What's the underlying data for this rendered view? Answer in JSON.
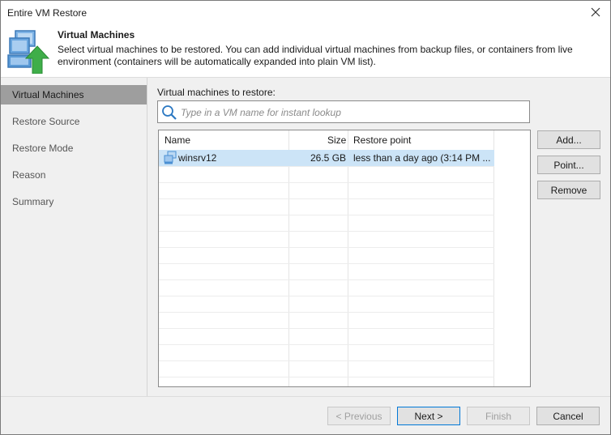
{
  "window": {
    "title": "Entire VM Restore"
  },
  "header": {
    "title": "Virtual Machines",
    "description": "Select virtual machines to be restored. You can add individual virtual machines from backup files, or containers from live environment (containers will be automatically expanded into plain VM list)."
  },
  "sidebar": {
    "items": [
      {
        "label": "Virtual Machines",
        "active": true
      },
      {
        "label": "Restore Source"
      },
      {
        "label": "Restore Mode"
      },
      {
        "label": "Reason"
      },
      {
        "label": "Summary"
      }
    ]
  },
  "main": {
    "list_label": "Virtual machines to restore:",
    "search": {
      "placeholder": "Type in a VM name for instant lookup",
      "value": ""
    },
    "table": {
      "columns": [
        "Name",
        "Size",
        "Restore point"
      ],
      "rows": [
        {
          "name": "winsrv12",
          "size": "26.5 GB",
          "restore_point": "less than a day ago (3:14 PM ..."
        }
      ]
    },
    "buttons": {
      "add": "Add...",
      "point": "Point...",
      "remove": "Remove"
    }
  },
  "footer": {
    "previous": "< Previous",
    "next": "Next >",
    "finish": "Finish",
    "cancel": "Cancel"
  },
  "colors": {
    "selection": "#cce4f7",
    "sidebar_active": "#9e9e9e",
    "panel": "#f0f0f0",
    "accent_arrow": "#3fae49",
    "vm_icon": "#4a8fd3"
  }
}
